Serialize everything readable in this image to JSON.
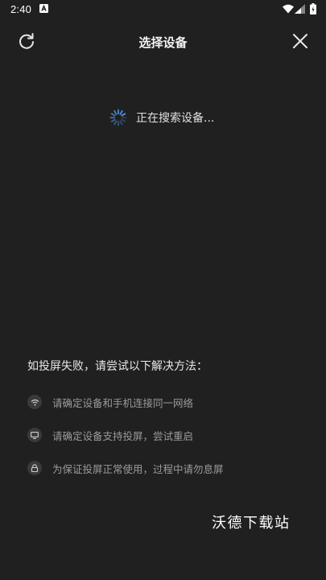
{
  "status_bar": {
    "time": "2:40"
  },
  "header": {
    "title": "选择设备"
  },
  "searching": {
    "text": "正在搜索设备..."
  },
  "help": {
    "title": "如投屏失败，请尝试以下解决方法：",
    "items": [
      {
        "icon": "wifi-icon",
        "text": "请确定设备和手机连接同一网络"
      },
      {
        "icon": "monitor-icon",
        "text": "请确定设备支持投屏，尝试重启"
      },
      {
        "icon": "lock-icon",
        "text": "为保证投屏正常使用，过程中请勿息屏"
      }
    ]
  },
  "watermark": "沃德下载站",
  "colors": {
    "background": "#202020",
    "spinner": "#4a90e2",
    "text_secondary": "#9b9b9b"
  }
}
